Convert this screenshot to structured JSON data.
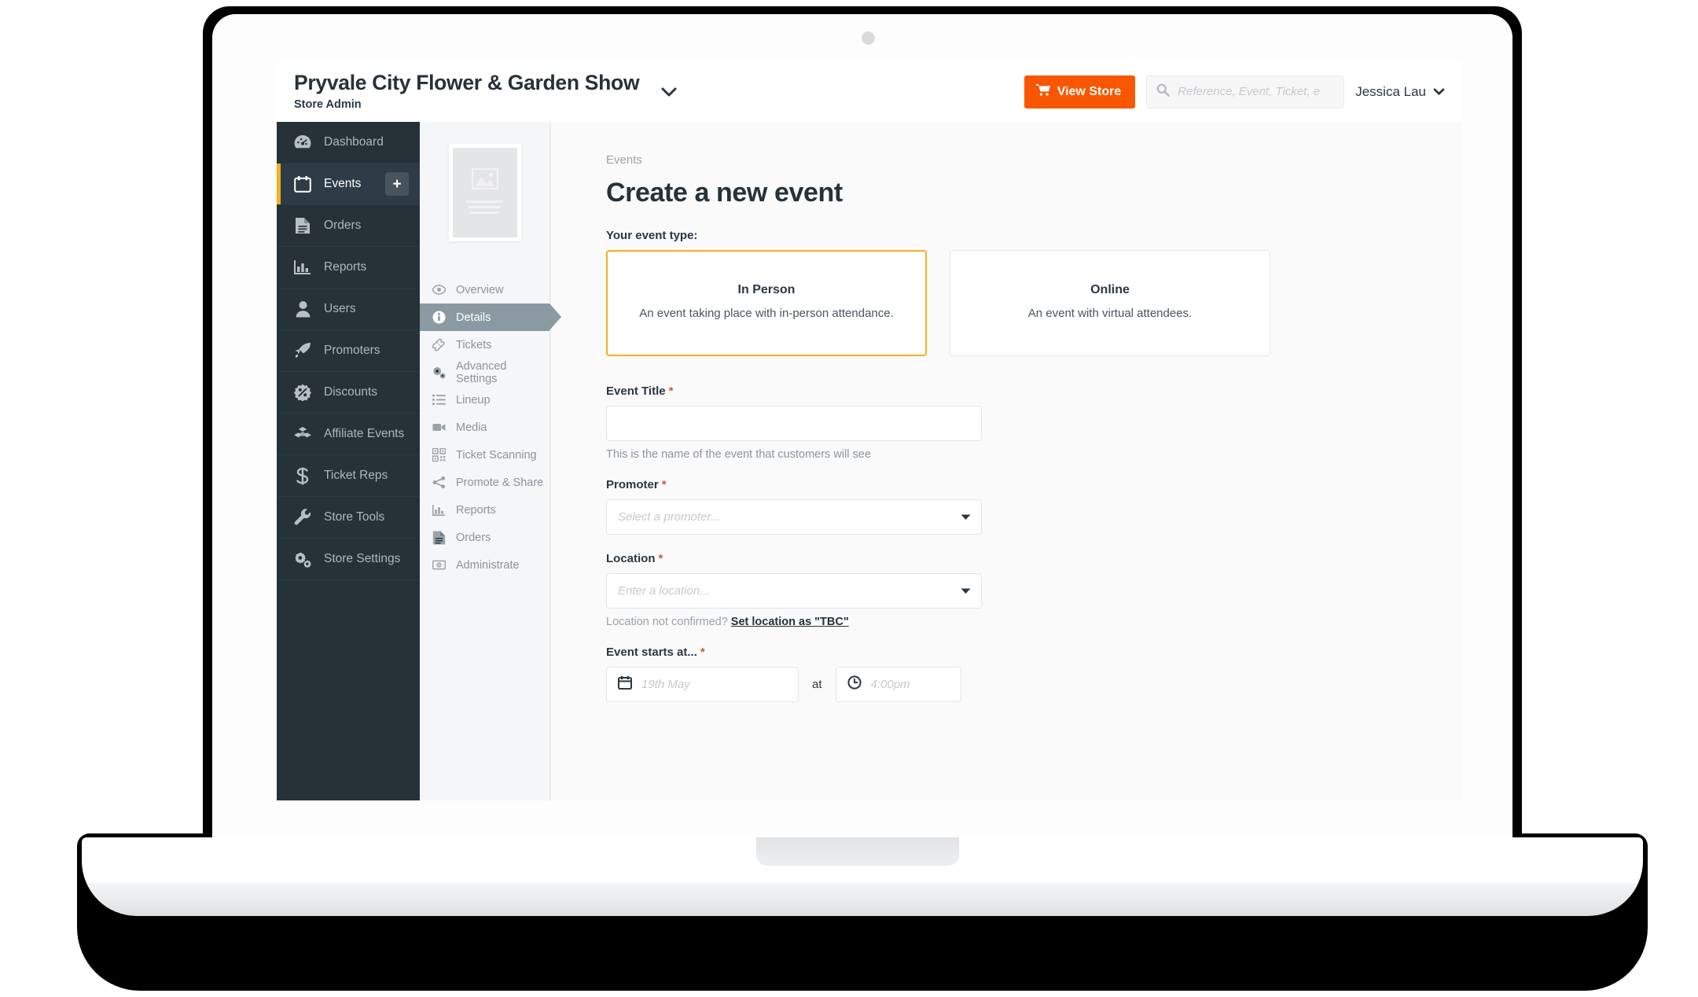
{
  "header": {
    "store_name": "Pryvale City Flower & Garden Show",
    "store_role": "Store Admin",
    "view_store_label": "View Store",
    "search_placeholder": "Reference, Event, Ticket, e",
    "search_value": "",
    "user_name": "Jessica Lau"
  },
  "sidebar": {
    "items": [
      {
        "label": "Dashboard",
        "icon": "gauge-icon",
        "active": false
      },
      {
        "label": "Events",
        "icon": "calendar-icon",
        "active": true,
        "add_label": "+"
      },
      {
        "label": "Orders",
        "icon": "document-icon",
        "active": false
      },
      {
        "label": "Reports",
        "icon": "bar-chart-icon",
        "active": false
      },
      {
        "label": "Users",
        "icon": "user-icon",
        "active": false
      },
      {
        "label": "Promoters",
        "icon": "rocket-icon",
        "active": false
      },
      {
        "label": "Discounts",
        "icon": "percent-badge-icon",
        "active": false
      },
      {
        "label": "Affiliate Events",
        "icon": "boxes-icon",
        "active": false
      },
      {
        "label": "Ticket Reps",
        "icon": "dollar-icon",
        "active": false
      },
      {
        "label": "Store Tools",
        "icon": "wrench-icon",
        "active": false
      },
      {
        "label": "Store Settings",
        "icon": "gears-icon",
        "active": false
      }
    ]
  },
  "subnav": {
    "items": [
      {
        "label": "Overview",
        "icon": "eye-icon",
        "active": false
      },
      {
        "label": "Details",
        "icon": "info-circle-icon",
        "active": true
      },
      {
        "label": "Tickets",
        "icon": "ticket-icon",
        "active": false
      },
      {
        "label": "Advanced Settings",
        "icon": "gears-icon",
        "active": false
      },
      {
        "label": "Lineup",
        "icon": "list-icon",
        "active": false
      },
      {
        "label": "Media",
        "icon": "video-camera-icon",
        "active": false
      },
      {
        "label": "Ticket Scanning",
        "icon": "qr-code-icon",
        "active": false
      },
      {
        "label": "Promote & Share",
        "icon": "share-icon",
        "active": false
      },
      {
        "label": "Reports",
        "icon": "bar-chart-icon",
        "active": false
      },
      {
        "label": "Orders",
        "icon": "document-icon",
        "active": false
      },
      {
        "label": "Administrate",
        "icon": "money-icon",
        "active": false
      }
    ]
  },
  "main": {
    "breadcrumb": "Events",
    "page_title": "Create a new event",
    "event_type_label": "Your event type:",
    "event_types": [
      {
        "title": "In Person",
        "description": "An event taking place with in-person attendance.",
        "selected": true
      },
      {
        "title": "Online",
        "description": "An event with virtual attendees.",
        "selected": false
      }
    ],
    "fields": {
      "event_title": {
        "label": "Event Title",
        "required_mark": "*",
        "value": "",
        "placeholder": "",
        "hint": "This is the name of the event that customers will see"
      },
      "promoter": {
        "label": "Promoter",
        "required_mark": "*",
        "value": "",
        "placeholder": "Select a promoter..."
      },
      "location": {
        "label": "Location",
        "required_mark": "*",
        "value": "",
        "placeholder": "Enter a location...",
        "hint_prefix": "Location not confirmed?",
        "hint_link": "Set location as \"TBC\""
      },
      "event_starts": {
        "label": "Event starts at...",
        "required_mark": "*",
        "date_placeholder": "19th May",
        "date_value": "",
        "separator": "at",
        "time_placeholder": "4:00pm",
        "time_value": ""
      }
    }
  },
  "colors": {
    "accent_orange": "#f95601",
    "accent_yellow": "#f5b021",
    "sidebar_dark": "#263238",
    "subnav_active": "#8b99a3",
    "required_star": "#c0632a"
  }
}
